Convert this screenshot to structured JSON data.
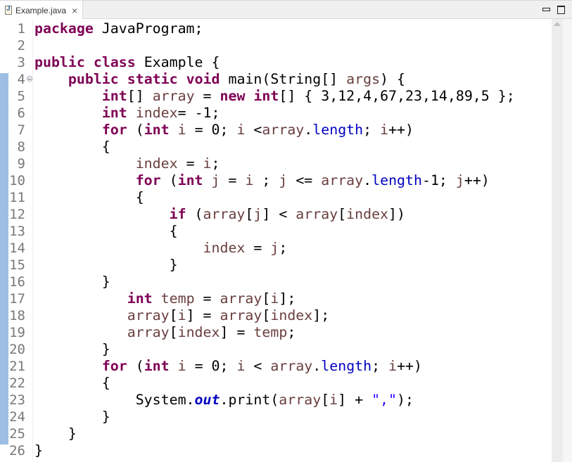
{
  "tab": {
    "title": "Example.java",
    "icon": "java-file-icon",
    "close_icon": "×"
  },
  "window_controls": {
    "minimize": "minimize-icon",
    "maximize": "maximize-icon"
  },
  "editor": {
    "first_line": 1,
    "folded_line": 4,
    "change_bar_lines": [
      4,
      25
    ],
    "lines": [
      [
        {
          "t": "package",
          "c": "kw"
        },
        {
          "t": " JavaProgram;"
        }
      ],
      [],
      [
        {
          "t": "public",
          "c": "kw"
        },
        {
          "t": " "
        },
        {
          "t": "class",
          "c": "kw"
        },
        {
          "t": " Example {"
        }
      ],
      [
        {
          "t": "    "
        },
        {
          "t": "public",
          "c": "kw"
        },
        {
          "t": " "
        },
        {
          "t": "static",
          "c": "kw"
        },
        {
          "t": " "
        },
        {
          "t": "void",
          "c": "kw"
        },
        {
          "t": " main(String[] "
        },
        {
          "t": "args",
          "c": "var"
        },
        {
          "t": ") {"
        }
      ],
      [
        {
          "t": "        "
        },
        {
          "t": "int",
          "c": "kw"
        },
        {
          "t": "[] "
        },
        {
          "t": "array",
          "c": "var"
        },
        {
          "t": " = "
        },
        {
          "t": "new",
          "c": "kw"
        },
        {
          "t": " "
        },
        {
          "t": "int",
          "c": "kw"
        },
        {
          "t": "[] { 3,12,4,67,23,14,89,5 };"
        }
      ],
      [
        {
          "t": "        "
        },
        {
          "t": "int",
          "c": "kw"
        },
        {
          "t": " "
        },
        {
          "t": "index",
          "c": "var"
        },
        {
          "t": "= -1;"
        }
      ],
      [
        {
          "t": "        "
        },
        {
          "t": "for",
          "c": "kw"
        },
        {
          "t": " ("
        },
        {
          "t": "int",
          "c": "kw"
        },
        {
          "t": " "
        },
        {
          "t": "i",
          "c": "var"
        },
        {
          "t": " = 0; "
        },
        {
          "t": "i",
          "c": "var"
        },
        {
          "t": " <"
        },
        {
          "t": "array",
          "c": "var"
        },
        {
          "t": "."
        },
        {
          "t": "length",
          "c": "field"
        },
        {
          "t": "; "
        },
        {
          "t": "i",
          "c": "var"
        },
        {
          "t": "++)"
        }
      ],
      [
        {
          "t": "        {"
        }
      ],
      [
        {
          "t": "            "
        },
        {
          "t": "index",
          "c": "var"
        },
        {
          "t": " = "
        },
        {
          "t": "i",
          "c": "var"
        },
        {
          "t": ";"
        }
      ],
      [
        {
          "t": "            "
        },
        {
          "t": "for",
          "c": "kw"
        },
        {
          "t": " ("
        },
        {
          "t": "int",
          "c": "kw"
        },
        {
          "t": " "
        },
        {
          "t": "j",
          "c": "var"
        },
        {
          "t": " = "
        },
        {
          "t": "i",
          "c": "var"
        },
        {
          "t": " ; "
        },
        {
          "t": "j",
          "c": "var"
        },
        {
          "t": " <= "
        },
        {
          "t": "array",
          "c": "var"
        },
        {
          "t": "."
        },
        {
          "t": "length",
          "c": "field"
        },
        {
          "t": "-1; "
        },
        {
          "t": "j",
          "c": "var"
        },
        {
          "t": "++)"
        }
      ],
      [
        {
          "t": "            {"
        }
      ],
      [
        {
          "t": "                "
        },
        {
          "t": "if",
          "c": "kw"
        },
        {
          "t": " ("
        },
        {
          "t": "array",
          "c": "var"
        },
        {
          "t": "["
        },
        {
          "t": "j",
          "c": "var"
        },
        {
          "t": "] < "
        },
        {
          "t": "array",
          "c": "var"
        },
        {
          "t": "["
        },
        {
          "t": "index",
          "c": "var"
        },
        {
          "t": "])"
        }
      ],
      [
        {
          "t": "                {"
        }
      ],
      [
        {
          "t": "                    "
        },
        {
          "t": "index",
          "c": "var"
        },
        {
          "t": " = "
        },
        {
          "t": "j",
          "c": "var"
        },
        {
          "t": ";"
        }
      ],
      [
        {
          "t": "                }"
        }
      ],
      [
        {
          "t": "        }"
        }
      ],
      [
        {
          "t": "           "
        },
        {
          "t": "int",
          "c": "kw"
        },
        {
          "t": " "
        },
        {
          "t": "temp",
          "c": "var"
        },
        {
          "t": " = "
        },
        {
          "t": "array",
          "c": "var"
        },
        {
          "t": "["
        },
        {
          "t": "i",
          "c": "var"
        },
        {
          "t": "];"
        }
      ],
      [
        {
          "t": "           "
        },
        {
          "t": "array",
          "c": "var"
        },
        {
          "t": "["
        },
        {
          "t": "i",
          "c": "var"
        },
        {
          "t": "] = "
        },
        {
          "t": "array",
          "c": "var"
        },
        {
          "t": "["
        },
        {
          "t": "index",
          "c": "var"
        },
        {
          "t": "];"
        }
      ],
      [
        {
          "t": "           "
        },
        {
          "t": "array",
          "c": "var"
        },
        {
          "t": "["
        },
        {
          "t": "index",
          "c": "var"
        },
        {
          "t": "] = "
        },
        {
          "t": "temp",
          "c": "var"
        },
        {
          "t": ";"
        }
      ],
      [
        {
          "t": "        }"
        }
      ],
      [
        {
          "t": "        "
        },
        {
          "t": "for",
          "c": "kw"
        },
        {
          "t": " ("
        },
        {
          "t": "int",
          "c": "kw"
        },
        {
          "t": " "
        },
        {
          "t": "i",
          "c": "var"
        },
        {
          "t": " = 0; "
        },
        {
          "t": "i",
          "c": "var"
        },
        {
          "t": " < "
        },
        {
          "t": "array",
          "c": "var"
        },
        {
          "t": "."
        },
        {
          "t": "length",
          "c": "field"
        },
        {
          "t": "; "
        },
        {
          "t": "i",
          "c": "var"
        },
        {
          "t": "++)"
        }
      ],
      [
        {
          "t": "        {"
        }
      ],
      [
        {
          "t": "            System."
        },
        {
          "t": "out",
          "c": "sfield"
        },
        {
          "t": ".print("
        },
        {
          "t": "array",
          "c": "var"
        },
        {
          "t": "["
        },
        {
          "t": "i",
          "c": "var"
        },
        {
          "t": "] + "
        },
        {
          "t": "\",\"",
          "c": "str"
        },
        {
          "t": ");"
        }
      ],
      [
        {
          "t": "        }"
        }
      ],
      [
        {
          "t": "    }"
        }
      ],
      [
        {
          "t": "}"
        }
      ]
    ]
  }
}
